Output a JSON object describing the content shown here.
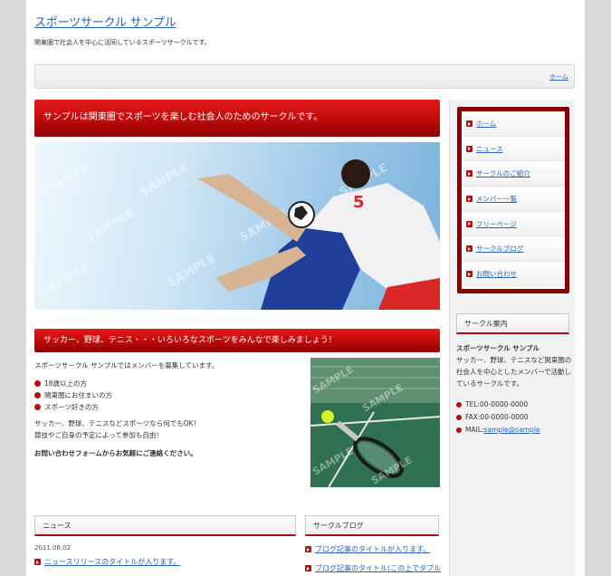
{
  "site": {
    "title": "スポーツサークル サンプル",
    "description": "関東圏で社会人を中心に活同しているスポーツサークルです。"
  },
  "topbar": {
    "home_link": "ホーム"
  },
  "main": {
    "banner_title": "サンプルは関東圏でスポーツを楽しむ社会人のためのサークルです。",
    "hero_watermark": "SAMPLE",
    "sub_banner": "サッカー、野球、テニス・・・いろいろなスポーツをみんなで楽しみましょう！",
    "intro_text": "スポーツサークル サンプルではメンバーを募集しています。",
    "requirements": [
      "18歳以上の方",
      "関東圏にお住まいの方",
      "スポーツ好きの方"
    ],
    "sports_line1": "サッカー、野球、テニスなどスポーツなら何でもOK！",
    "sports_line2": "競技やご自身の予定によって参加も自由！",
    "contact_cta": "お問い合わせフォームからお気軽にご連絡ください。"
  },
  "news": {
    "heading": "ニュース",
    "date": "2011.06.02",
    "items": [
      "ニュースリリースのタイトルが入ります。"
    ]
  },
  "blog": {
    "heading": "サークルブログ",
    "items": [
      "ブログ記事のタイトルが入ります。",
      "ブログ記事のタイトル(この上でダブル"
    ]
  },
  "sidebar": {
    "nav": [
      "ホーム",
      "ニュース",
      "サークルのご紹介",
      "メンバー一覧",
      "フリーページ",
      "サークルブログ",
      "お問い合わせ"
    ],
    "guide_heading": "サークル案内",
    "guide_title": "スポーツサークル サンプル",
    "guide_text": "サッカー、野球、テニスなど関東圏の社会人を中心としたメンバーで活動しているサークルです。",
    "tel": "TEL:00-0000-0000",
    "fax": "FAX:00-0000-0000",
    "mail_label": "MAIL:",
    "mail_link": "sample@sample"
  },
  "colors": {
    "accent_red": "#c70d0d",
    "link_blue": "#2e64b8"
  }
}
